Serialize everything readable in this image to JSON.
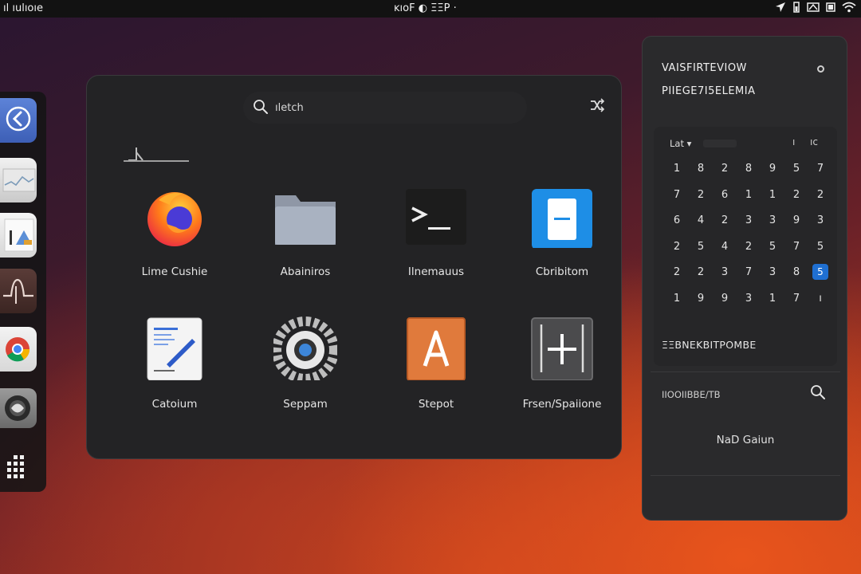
{
  "topbar": {
    "activities": "ıl ıulıoıe",
    "clock": "ĸıoF  ◐ ΞΞP ·"
  },
  "launcher": {
    "search_placeholder": "ıletch",
    "apps": [
      {
        "label": "Lime Cushie",
        "icon": "firefox-icon"
      },
      {
        "label": "Abainiros",
        "icon": "folder-icon"
      },
      {
        "label": "Ilnemauus",
        "icon": "terminal-icon"
      },
      {
        "label": "Cbribitom",
        "icon": "notes-icon"
      },
      {
        "label": "Catoium",
        "icon": "text-editor-icon"
      },
      {
        "label": "Seppam",
        "icon": "settings-gear-icon"
      },
      {
        "label": "Stepot",
        "icon": "font-icon"
      },
      {
        "label": "Frsen/Spaiione",
        "icon": "add-icon"
      }
    ]
  },
  "panel": {
    "title_line1": "VAISFIRTEVIOW",
    "title_line2": "PIIEGE7I5ELEMIA",
    "calendar": {
      "month": "Lat ▾",
      "prev": "ı",
      "next": "ıc",
      "rows": [
        [
          "1",
          "8",
          "2",
          "8",
          "9",
          "5",
          "7"
        ],
        [
          "7",
          "2",
          "6",
          "1",
          "1",
          "2",
          "2"
        ],
        [
          "6",
          "4",
          "2",
          "3",
          "3",
          "9",
          "3"
        ],
        [
          "2",
          "5",
          "4",
          "2",
          "5",
          "7",
          "5"
        ],
        [
          "2",
          "2",
          "3",
          "7",
          "3",
          "8",
          "5"
        ],
        [
          "1",
          "9",
          "9",
          "3",
          "1",
          "7",
          "ı"
        ]
      ],
      "today": "5",
      "events_label": "ΞΞBNEKBITPOMBE"
    },
    "notifications_title": "IIOOIIBBE/TB",
    "no_events": "NaD Gaiun"
  },
  "colors": {
    "accent": "#1f6fd1",
    "panel_bg": "#232325"
  }
}
